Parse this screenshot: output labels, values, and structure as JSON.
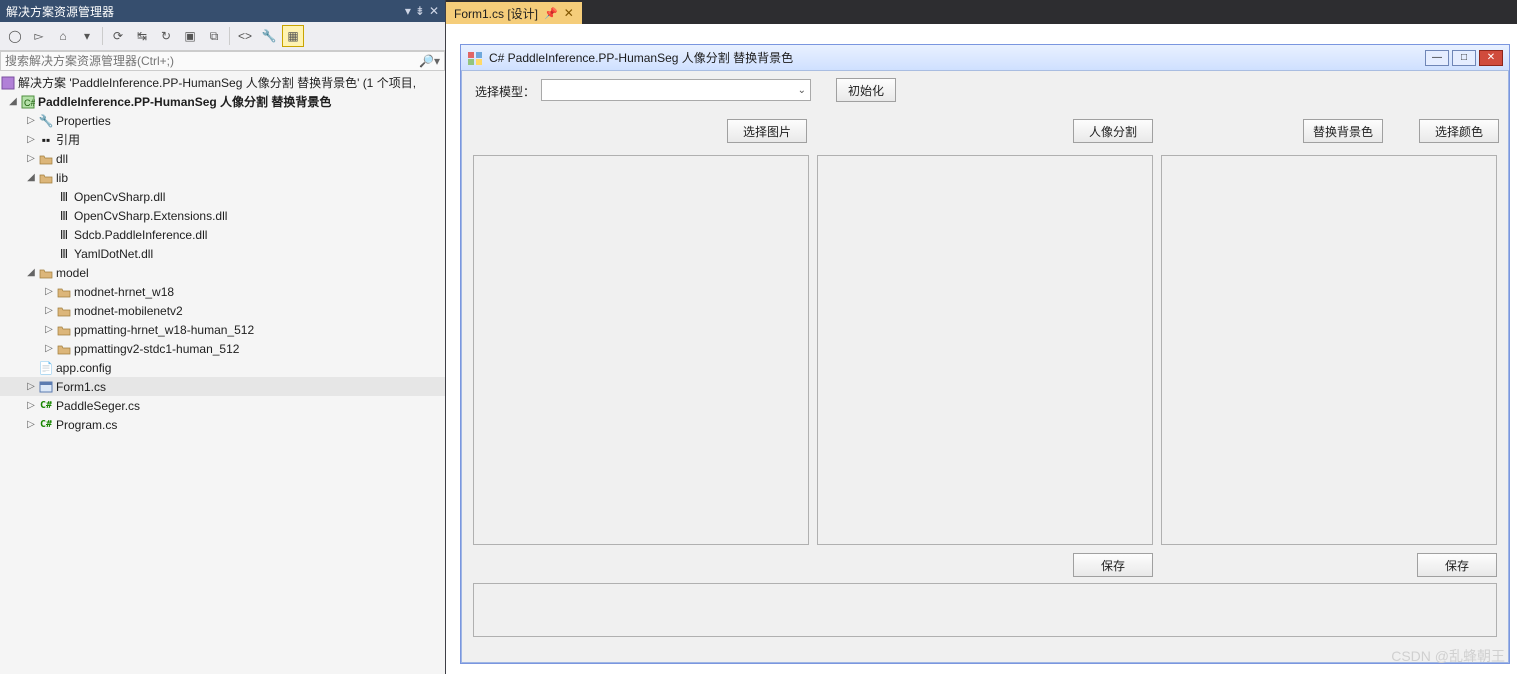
{
  "solexp": {
    "title": "解决方案资源管理器",
    "search_placeholder": "搜索解决方案资源管理器(Ctrl+;)",
    "solution_text": "解决方案 'PaddleInference.PP-HumanSeg 人像分割 替换背景色' (1 个项目,",
    "project_name": "PaddleInference.PP-HumanSeg 人像分割 替换背景色",
    "items": {
      "properties": "Properties",
      "references": "引用",
      "dll": "dll",
      "lib": "lib",
      "lib_children": [
        "OpenCvSharp.dll",
        "OpenCvSharp.Extensions.dll",
        "Sdcb.PaddleInference.dll",
        "YamlDotNet.dll"
      ],
      "model": "model",
      "model_children": [
        "modnet-hrnet_w18",
        "modnet-mobilenetv2",
        "ppmatting-hrnet_w18-human_512",
        "ppmattingv2-stdc1-human_512"
      ],
      "appconfig": "app.config",
      "form1": "Form1.cs",
      "paddleseger": "PaddleSeger.cs",
      "program": "Program.cs"
    }
  },
  "tab": {
    "label": "Form1.cs [设计]"
  },
  "winform": {
    "title": "C# PaddleInference.PP-HumanSeg 人像分割 替换背景色",
    "label_model": "选择模型：",
    "btn_init": "初始化",
    "btn_select_img": "选择图片",
    "btn_seg": "人像分割",
    "btn_replace_bg": "替换背景色",
    "btn_select_color": "选择颜色",
    "btn_save": "保存"
  },
  "watermark": "CSDN @乱蜂朝王"
}
